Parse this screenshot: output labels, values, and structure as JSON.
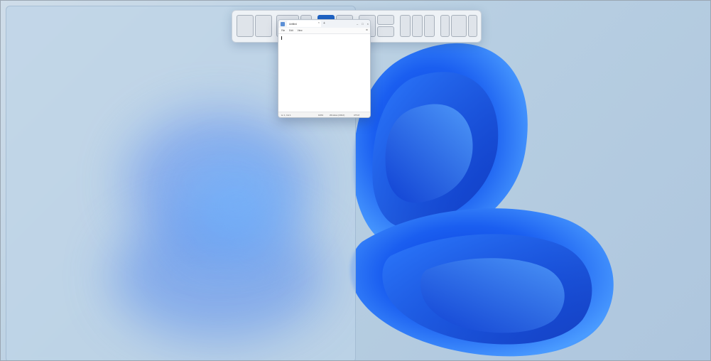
{
  "desktop": {
    "wallpaper": "windows-11-bloom",
    "accent_color": "#1f63c4"
  },
  "snap_layouts": {
    "groups": [
      {
        "name": "two-equal",
        "zones": 2
      },
      {
        "name": "two-wide-narrow",
        "zones": 2,
        "active_zone": 1
      },
      {
        "name": "three-columns",
        "zones": 3,
        "active_zone": 2
      },
      {
        "name": "grid-four",
        "zones": 4
      },
      {
        "name": "three-equal-columns",
        "zones": 3
      },
      {
        "name": "three-columns-center-wide",
        "zones": 3
      }
    ]
  },
  "notepad": {
    "tab_title": "Untitled",
    "tab_close": "×",
    "new_tab": "+",
    "caption": {
      "minimize": "–",
      "maximize": "□",
      "close": "×"
    },
    "menu": {
      "file": "File",
      "edit": "Edit",
      "view": "View"
    },
    "settings_icon": "⚙",
    "status": {
      "position": "Ln 1, Col 1",
      "zoom": "100%",
      "line_ending": "Windows (CRLF)",
      "encoding": "UTF-8"
    }
  }
}
